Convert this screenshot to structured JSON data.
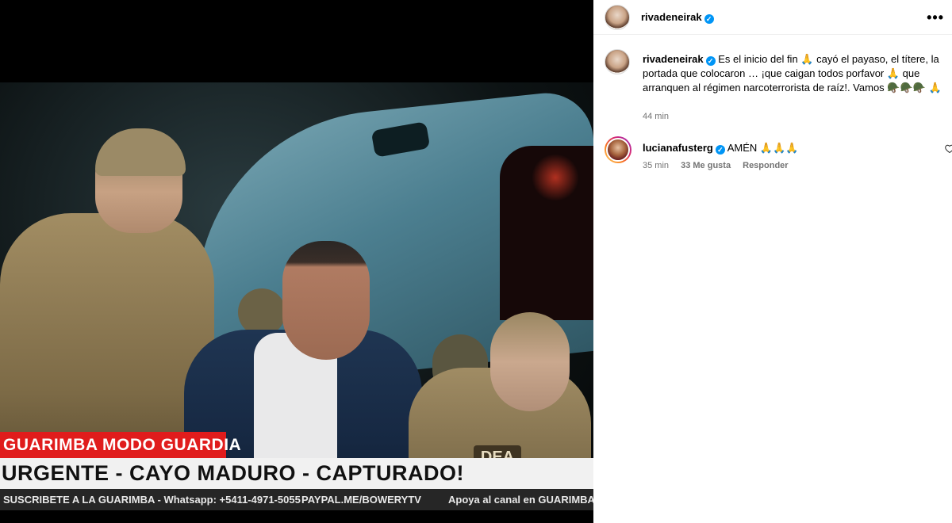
{
  "post": {
    "image": {
      "banner_top": "GUARIMBA MODO GUARDIA",
      "banner_main": "URGENTE - CAYO MADURO - CAPTURADO!",
      "ticker": {
        "left": "SUSCRIBETE A LA GUARIMBA - Whatsapp: +5411-4971-5055",
        "middle": "PAYPAL.ME/BOWERYTV",
        "right": "Apoya al canal en GUARIMBA"
      },
      "patch_text": "DEA"
    }
  },
  "header": {
    "username": "rivadeneirak",
    "more_icon": "more-horizontal-icon"
  },
  "caption": {
    "username": "rivadeneirak",
    "text": "Es el inicio del fin 🙏 cayó el payaso, el títere, la portada que colocaron … ¡que caigan todos porfavor 🙏 que arranquen al régimen narcoterrorista de raíz!. Vamos 🪖🪖🪖 🙏",
    "time": "44 min"
  },
  "comments": [
    {
      "username": "lucianafusterg",
      "text": "AMÉN 🙏🙏🙏",
      "time": "35 min",
      "likes": "33 Me gusta",
      "reply_label": "Responder"
    }
  ],
  "colors": {
    "verified": "#0095f6",
    "banner_red": "#e01c1c",
    "meta_gray": "#737373"
  }
}
